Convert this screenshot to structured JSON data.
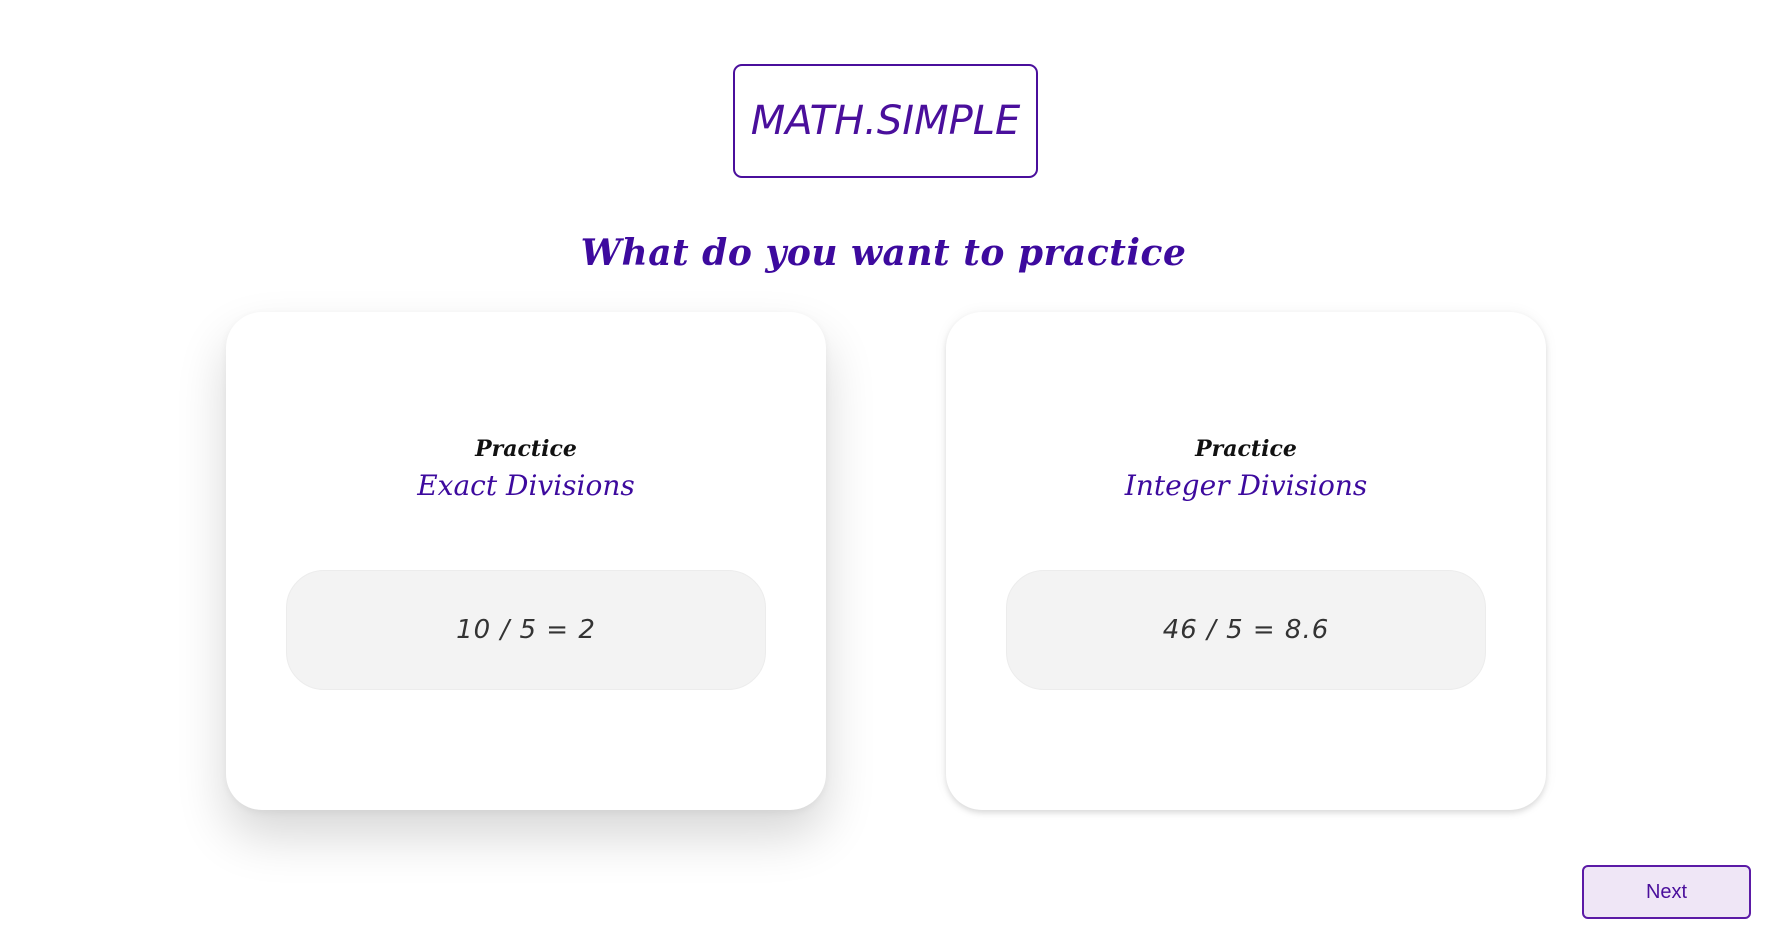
{
  "app": {
    "logo_text": "MATH.SIMPLE",
    "brand_color": "#4a0f9c"
  },
  "main": {
    "heading": "What do you want to practice",
    "cards": [
      {
        "kicker": "Practice",
        "title": "Exact Divisions",
        "example": "10 / 5 = 2",
        "state": "highlighted"
      },
      {
        "kicker": "Practice",
        "title": "Integer Divisions",
        "example": "46 / 5 = 8.6",
        "state": "default"
      }
    ]
  },
  "footer": {
    "next_label": "Next"
  }
}
